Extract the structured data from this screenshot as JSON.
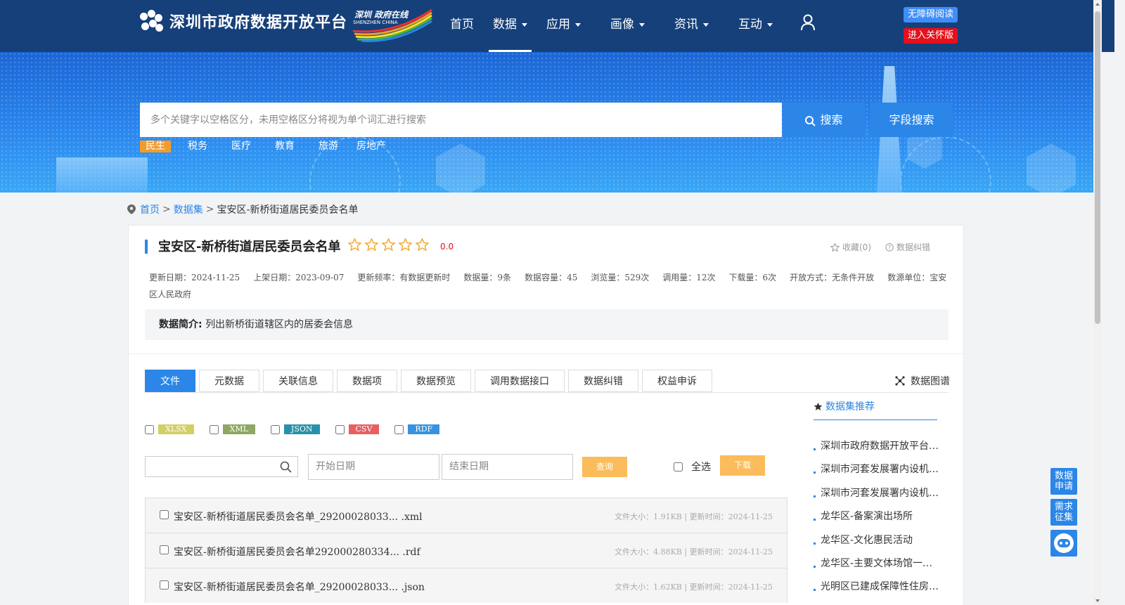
{
  "header": {
    "site_title": "深圳市政府数据开放平台",
    "badge_cn": "深圳 政府在线",
    "badge_en": "SHENZHEN CHINA",
    "nav": [
      {
        "label": "首页",
        "dropdown": false
      },
      {
        "label": "数据",
        "dropdown": true,
        "active": true
      },
      {
        "label": "应用",
        "dropdown": true
      },
      {
        "label": "画像",
        "dropdown": true
      },
      {
        "label": "资讯",
        "dropdown": true
      },
      {
        "label": "互动",
        "dropdown": true
      }
    ],
    "accessibility_label": "无障碍阅读",
    "care_label": "进入关怀版"
  },
  "search": {
    "placeholder": "多个关键字以空格区分，未用空格区分将视为单个词汇进行搜索",
    "search_label": "搜索",
    "field_search_label": "字段搜索",
    "tags": [
      "民生",
      "税务",
      "医疗",
      "教育",
      "旅游",
      "房地产"
    ]
  },
  "breadcrumb": {
    "home": "首页",
    "datasets": "数据集",
    "current": "宝安区-新桥街道居民委员会名单",
    "sep": ">"
  },
  "dataset": {
    "title": "宝安区-新桥街道居民委员会名单",
    "rating_score": "0.0",
    "rating_stars": 0,
    "favorite_label": "收藏(0)",
    "correction_label": "数据纠错",
    "meta": [
      "更新日期：2024-11-25",
      "上架日期：2023-09-07",
      "更新频率：有数据更新时",
      "数据量：9条",
      "数据容量：45",
      "浏览量：529次",
      "调用量：12次",
      "下载量：6次",
      "开放方式：无条件开放",
      "数源单位：宝安区人民政府"
    ],
    "intro_label": "数据简介:",
    "intro_text": "列出新桥街道辖区内的居委会信息"
  },
  "tabs": [
    "文件",
    "元数据",
    "关联信息",
    "数据项",
    "数据预览",
    "调用数据接口",
    "数据纠错",
    "权益申诉"
  ],
  "graph_link": "数据图谱",
  "formats": [
    {
      "label": "XLSX",
      "color": "#d4cf63"
    },
    {
      "label": "XML",
      "color": "#8ca861"
    },
    {
      "label": "JSON",
      "color": "#2592a9"
    },
    {
      "label": "CSV",
      "color": "#e86060"
    },
    {
      "label": "RDF",
      "color": "#3792e0"
    }
  ],
  "filters": {
    "start_date_placeholder": "开始日期",
    "end_date_placeholder": "结束日期",
    "query_label": "查询",
    "select_all_label": "全选",
    "download_label": "下载"
  },
  "files": [
    {
      "name": "宝安区-新桥街道居民委员会名单_29200028033... .xml",
      "info": "文件大小：1.91KB | 更新时间：2024-11-25"
    },
    {
      "name": "宝安区-新桥街道居民委员会名单292000280334... .rdf",
      "info": "文件大小：4.88KB | 更新时间：2024-11-25"
    },
    {
      "name": "宝安区-新桥街道居民委员会名单_29200028033... .json",
      "info": "文件大小：1.62KB | 更新时间：2024-11-25"
    }
  ],
  "recommend": {
    "title": "数据集推荐",
    "items": [
      "深圳市政府数据开放平台…",
      "深圳市河套发展署内设机…",
      "深圳市河套发展署内设机…",
      "龙华区-备案演出场所",
      "龙华区-文化惠民活动",
      "龙华区-主要文体场馆一…",
      "光明区已建成保障性住房…"
    ]
  },
  "side": {
    "apply_label": "数据申请",
    "demand_label": "需求征集"
  }
}
